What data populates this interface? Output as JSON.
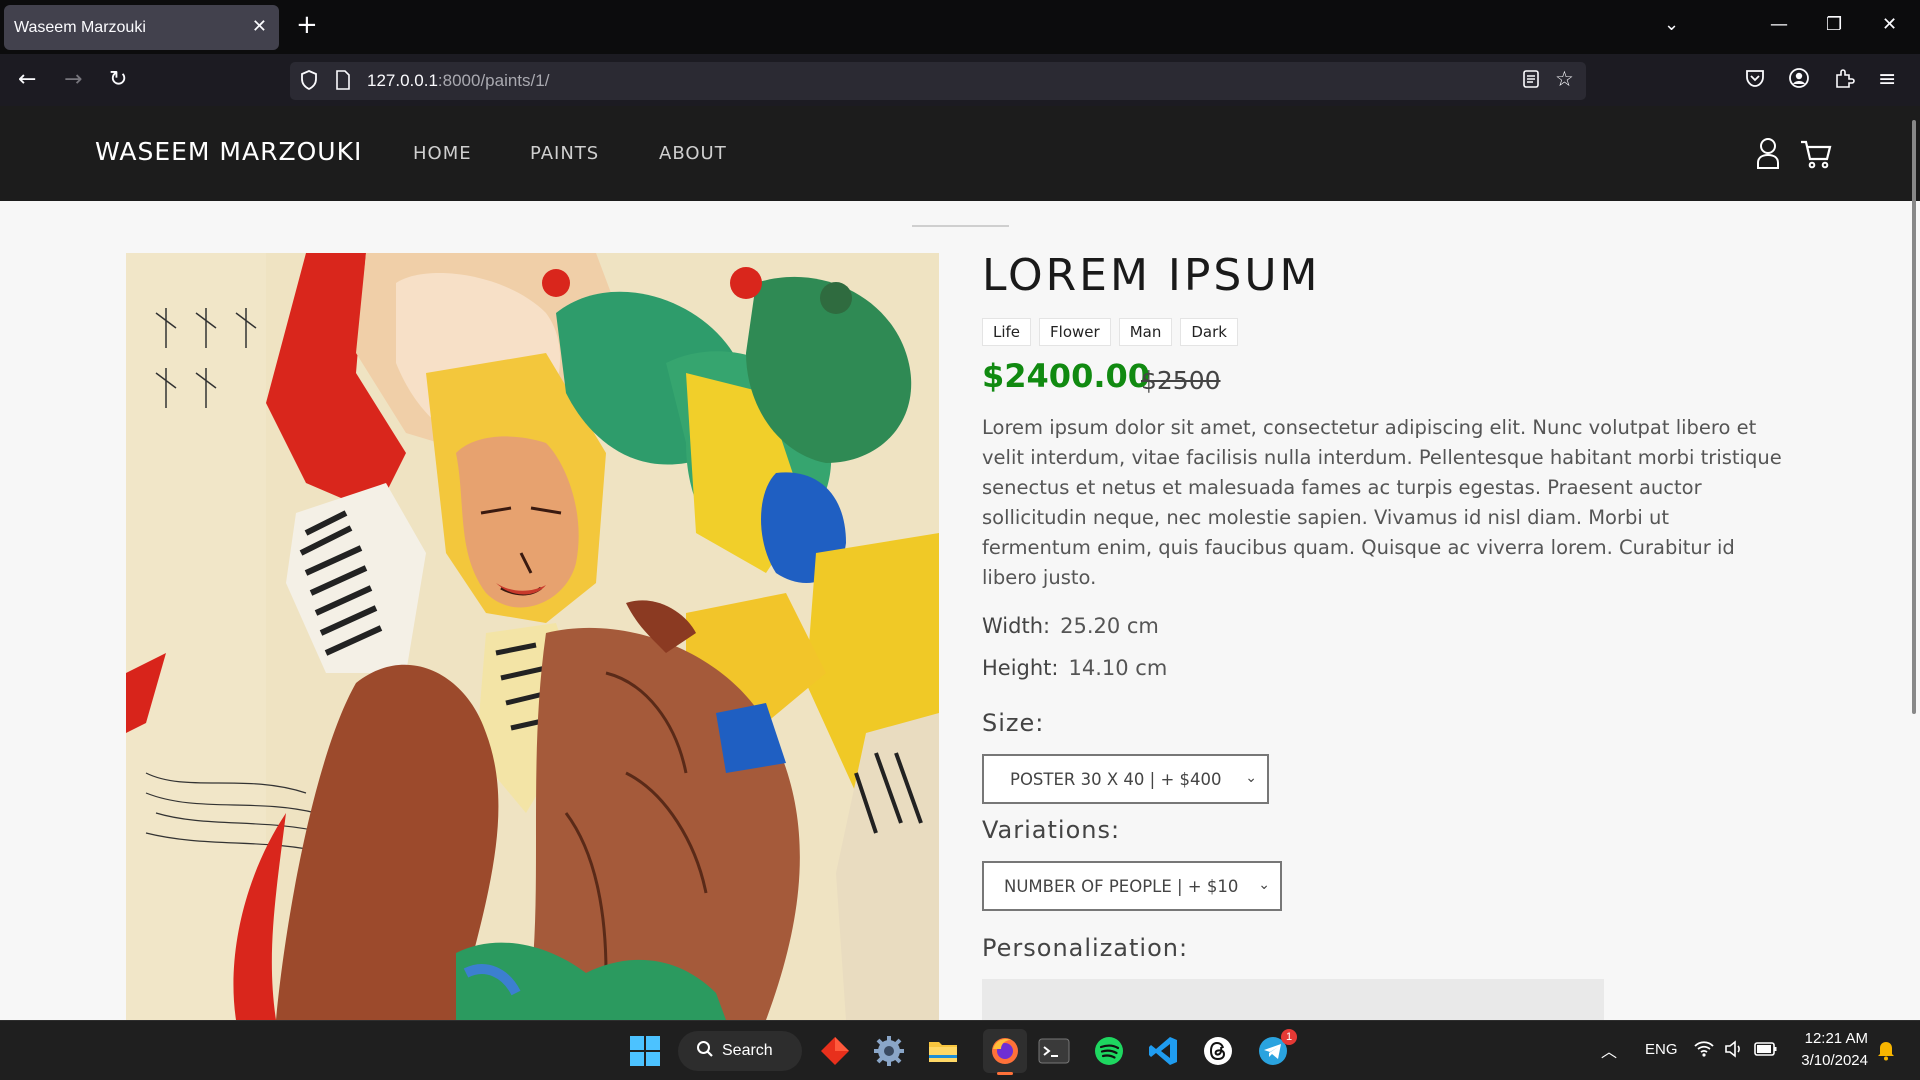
{
  "browser": {
    "tab_title": "Waseem Marzouki",
    "url_host": "127.0.0.1",
    "url_rest": ":8000/paints/1/"
  },
  "site": {
    "brand": "WASEEM MARZOUKI",
    "menu": [
      "HOME",
      "PAINTS",
      "ABOUT"
    ]
  },
  "product": {
    "title": "LOREM IPSUM",
    "tags": [
      "Life",
      "Flower",
      "Man",
      "Dark"
    ],
    "price": "$2400.00",
    "old_price": "$2500",
    "description": "Lorem ipsum dolor sit amet, consectetur adipiscing elit. Nunc volutpat libero et velit interdum, vitae facilisis nulla interdum. Pellentesque habitant morbi tristique senectus et netus et malesuada fames ac turpis egestas. Praesent auctor sollicitudin neque, nec molestie sapien. Vivamus id nisl diam. Morbi ut fermentum enim, quis faucibus quam. Quisque ac viverra lorem. Curabitur id libero justo.",
    "width_label": "Width:",
    "width_value": "25.20 cm",
    "height_label": "Height:",
    "height_value": "14.10 cm",
    "size_label": "Size:",
    "size_selected": "POSTER 30 X 40 | + $400",
    "variations_label": "Variations:",
    "variations_selected": "NUMBER OF PEOPLE | + $10",
    "personalization_label": "Personalization:"
  },
  "taskbar": {
    "search_label": "Search",
    "lang": "ENG",
    "time": "12:21 AM",
    "date": "3/10/2024",
    "telegram_badge": "1"
  },
  "colors": {
    "price_green": "#118a11",
    "header_bg": "#1c1c1c",
    "page_bg": "#f7f7f7"
  }
}
